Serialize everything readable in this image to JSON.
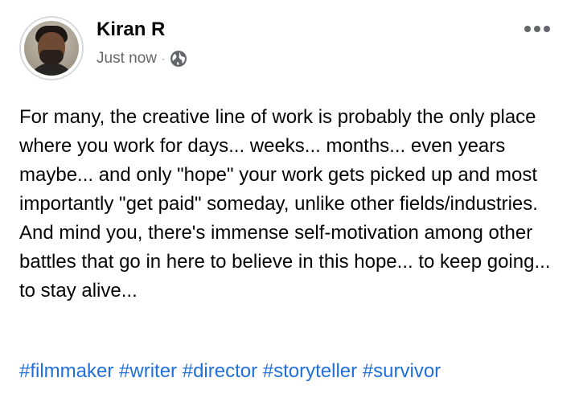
{
  "post": {
    "author": {
      "name": "Kiran R",
      "avatar_icon": "user-photo"
    },
    "timestamp": "Just now",
    "separator": "·",
    "privacy_icon": "globe-icon",
    "more_icon": "ellipsis-icon",
    "body_lines": [
      "For many, the creative line of work is probably the only place where you work for days... weeks... months... even years maybe... and only \"hope\" your work gets picked up and most importantly \"get paid\" someday, unlike other fields/industries.",
      "And mind you, there's immense self-motivation among other battles that go in here to believe in this hope... to keep going... to stay alive..."
    ],
    "hashtags": [
      "#filmmaker",
      "#writer",
      "#director",
      "#storyteller",
      "#survivor"
    ]
  },
  "colors": {
    "text": "#050505",
    "secondary": "#65676b",
    "link": "#216fdb",
    "avatar_border": "#d9dadc"
  }
}
